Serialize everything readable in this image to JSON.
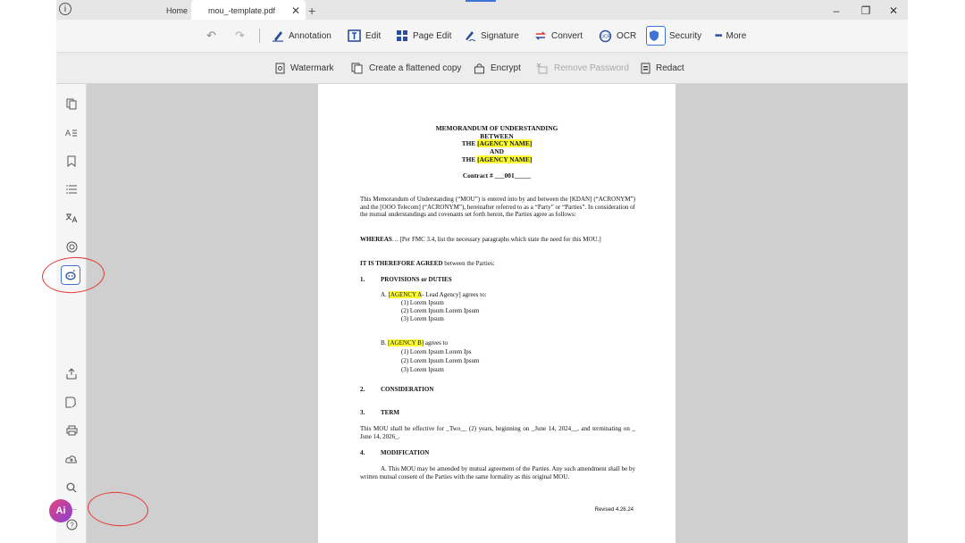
{
  "titlebar": {
    "info_icon": "i",
    "tabs": [
      {
        "label": "Home"
      },
      {
        "label": "mou_-template.pdf",
        "close": "✕"
      }
    ],
    "new_tab": "+",
    "window_controls": {
      "minimize": "–",
      "restore": "❐",
      "close": "✕"
    }
  },
  "toolbar": {
    "undo": "↶",
    "redo": "↷",
    "items": [
      {
        "label": "Annotation",
        "icon": "pen-icon"
      },
      {
        "label": "Edit",
        "icon": "edit-icon"
      },
      {
        "label": "Page Edit",
        "icon": "page-edit-icon"
      },
      {
        "label": "Signature",
        "icon": "signature-icon"
      },
      {
        "label": "Convert",
        "icon": "convert-icon"
      },
      {
        "label": "OCR",
        "icon": "ocr-icon"
      },
      {
        "label": "Security",
        "icon": "shield-icon"
      },
      {
        "label": "More",
        "icon": "more-dots-icon"
      }
    ],
    "more_dots": "•••"
  },
  "subtoolbar": {
    "items": [
      {
        "label": "Watermark",
        "icon": "watermark-icon",
        "enabled": true
      },
      {
        "label": "Create a flattened copy",
        "icon": "flatten-icon",
        "enabled": true
      },
      {
        "label": "Encrypt",
        "icon": "lock-icon",
        "enabled": true
      },
      {
        "label": "Remove Password",
        "icon": "remove-password-icon",
        "enabled": false
      },
      {
        "label": "Redact",
        "icon": "redact-icon",
        "enabled": true
      }
    ]
  },
  "sidebar": {
    "icons": [
      "pages-icon",
      "text-search-icon",
      "bookmark-icon",
      "outline-icon",
      "translate-icon",
      "ocr-icon",
      "ai-assistant-icon",
      "share-icon",
      "save-as-icon",
      "print-icon",
      "cloud-upload-icon",
      "search-icon",
      "help-icon"
    ],
    "ai_label": "Ai"
  },
  "document": {
    "title1": "MEMORANDUM OF UNDERSTANDING",
    "title2": "BETWEEN",
    "the": "THE",
    "agency_placeholder": "[AGENCY NAME]",
    "and": "AND",
    "contract": "Contract # ___001_____",
    "intro": "This Memorandum of Understanding (“MOU”) is entered into by and between the [KDAN] (“ACRONYM”) and the [OOO Telecom] (“ACRONYM”), hereinafter referred to as a “Party” or “Parties”. In consideration of the mutual understandings and covenants set forth herein, the Parties agree as follows:",
    "whereas_bold": "WHEREAS",
    "whereas_rest": "… [Per FMC 3.4, list the necessary paragraphs which state the need for this MOU.]",
    "agreed_bold": "IT IS THEREFORE AGREED",
    "agreed_rest": " between the Parties:",
    "s1_num": "1.",
    "s1_title": "PROVISIONS or DUTIES",
    "a_prefix": "A. ",
    "a_hl": "[AGENCY A",
    "a_rest": "- Lead Agency] agrees to:",
    "a_items": [
      "(1) Lorem Ipsum",
      "(2) Lorem Ipsum Lorem Ipsum",
      "(3) Lorem Ipsum"
    ],
    "b_prefix": "B. ",
    "b_hl": "[AGENCY B]",
    "b_rest": " agrees to",
    "b_items": [
      "(1) Lorem Ipsum Lorem Ips",
      "(2) Lorem Ipsum Lorem Ipsum",
      "(3) Lorem Ipsum"
    ],
    "s2_num": "2.",
    "s2_title": "CONSIDERATION",
    "s3_num": "3.",
    "s3_title": "TERM",
    "term_text": "This MOU shall be effective for _Two__ (2) years, beginning on _June 14, 2024__, and terminating on _ June 14, 2026_.",
    "s4_num": "4.",
    "s4_title": "MODIFICATION",
    "mod_text": "A. This MOU may be amended by mutual agreement of the Parties. Any such amendment shall be by written mutual consent of the Parties with the same formality as this original MOU.",
    "revised": "Revised 4.26.24"
  },
  "colors": {
    "accent": "#3f74d6",
    "highlight": "#ffff33",
    "annotation": "#e53935"
  }
}
